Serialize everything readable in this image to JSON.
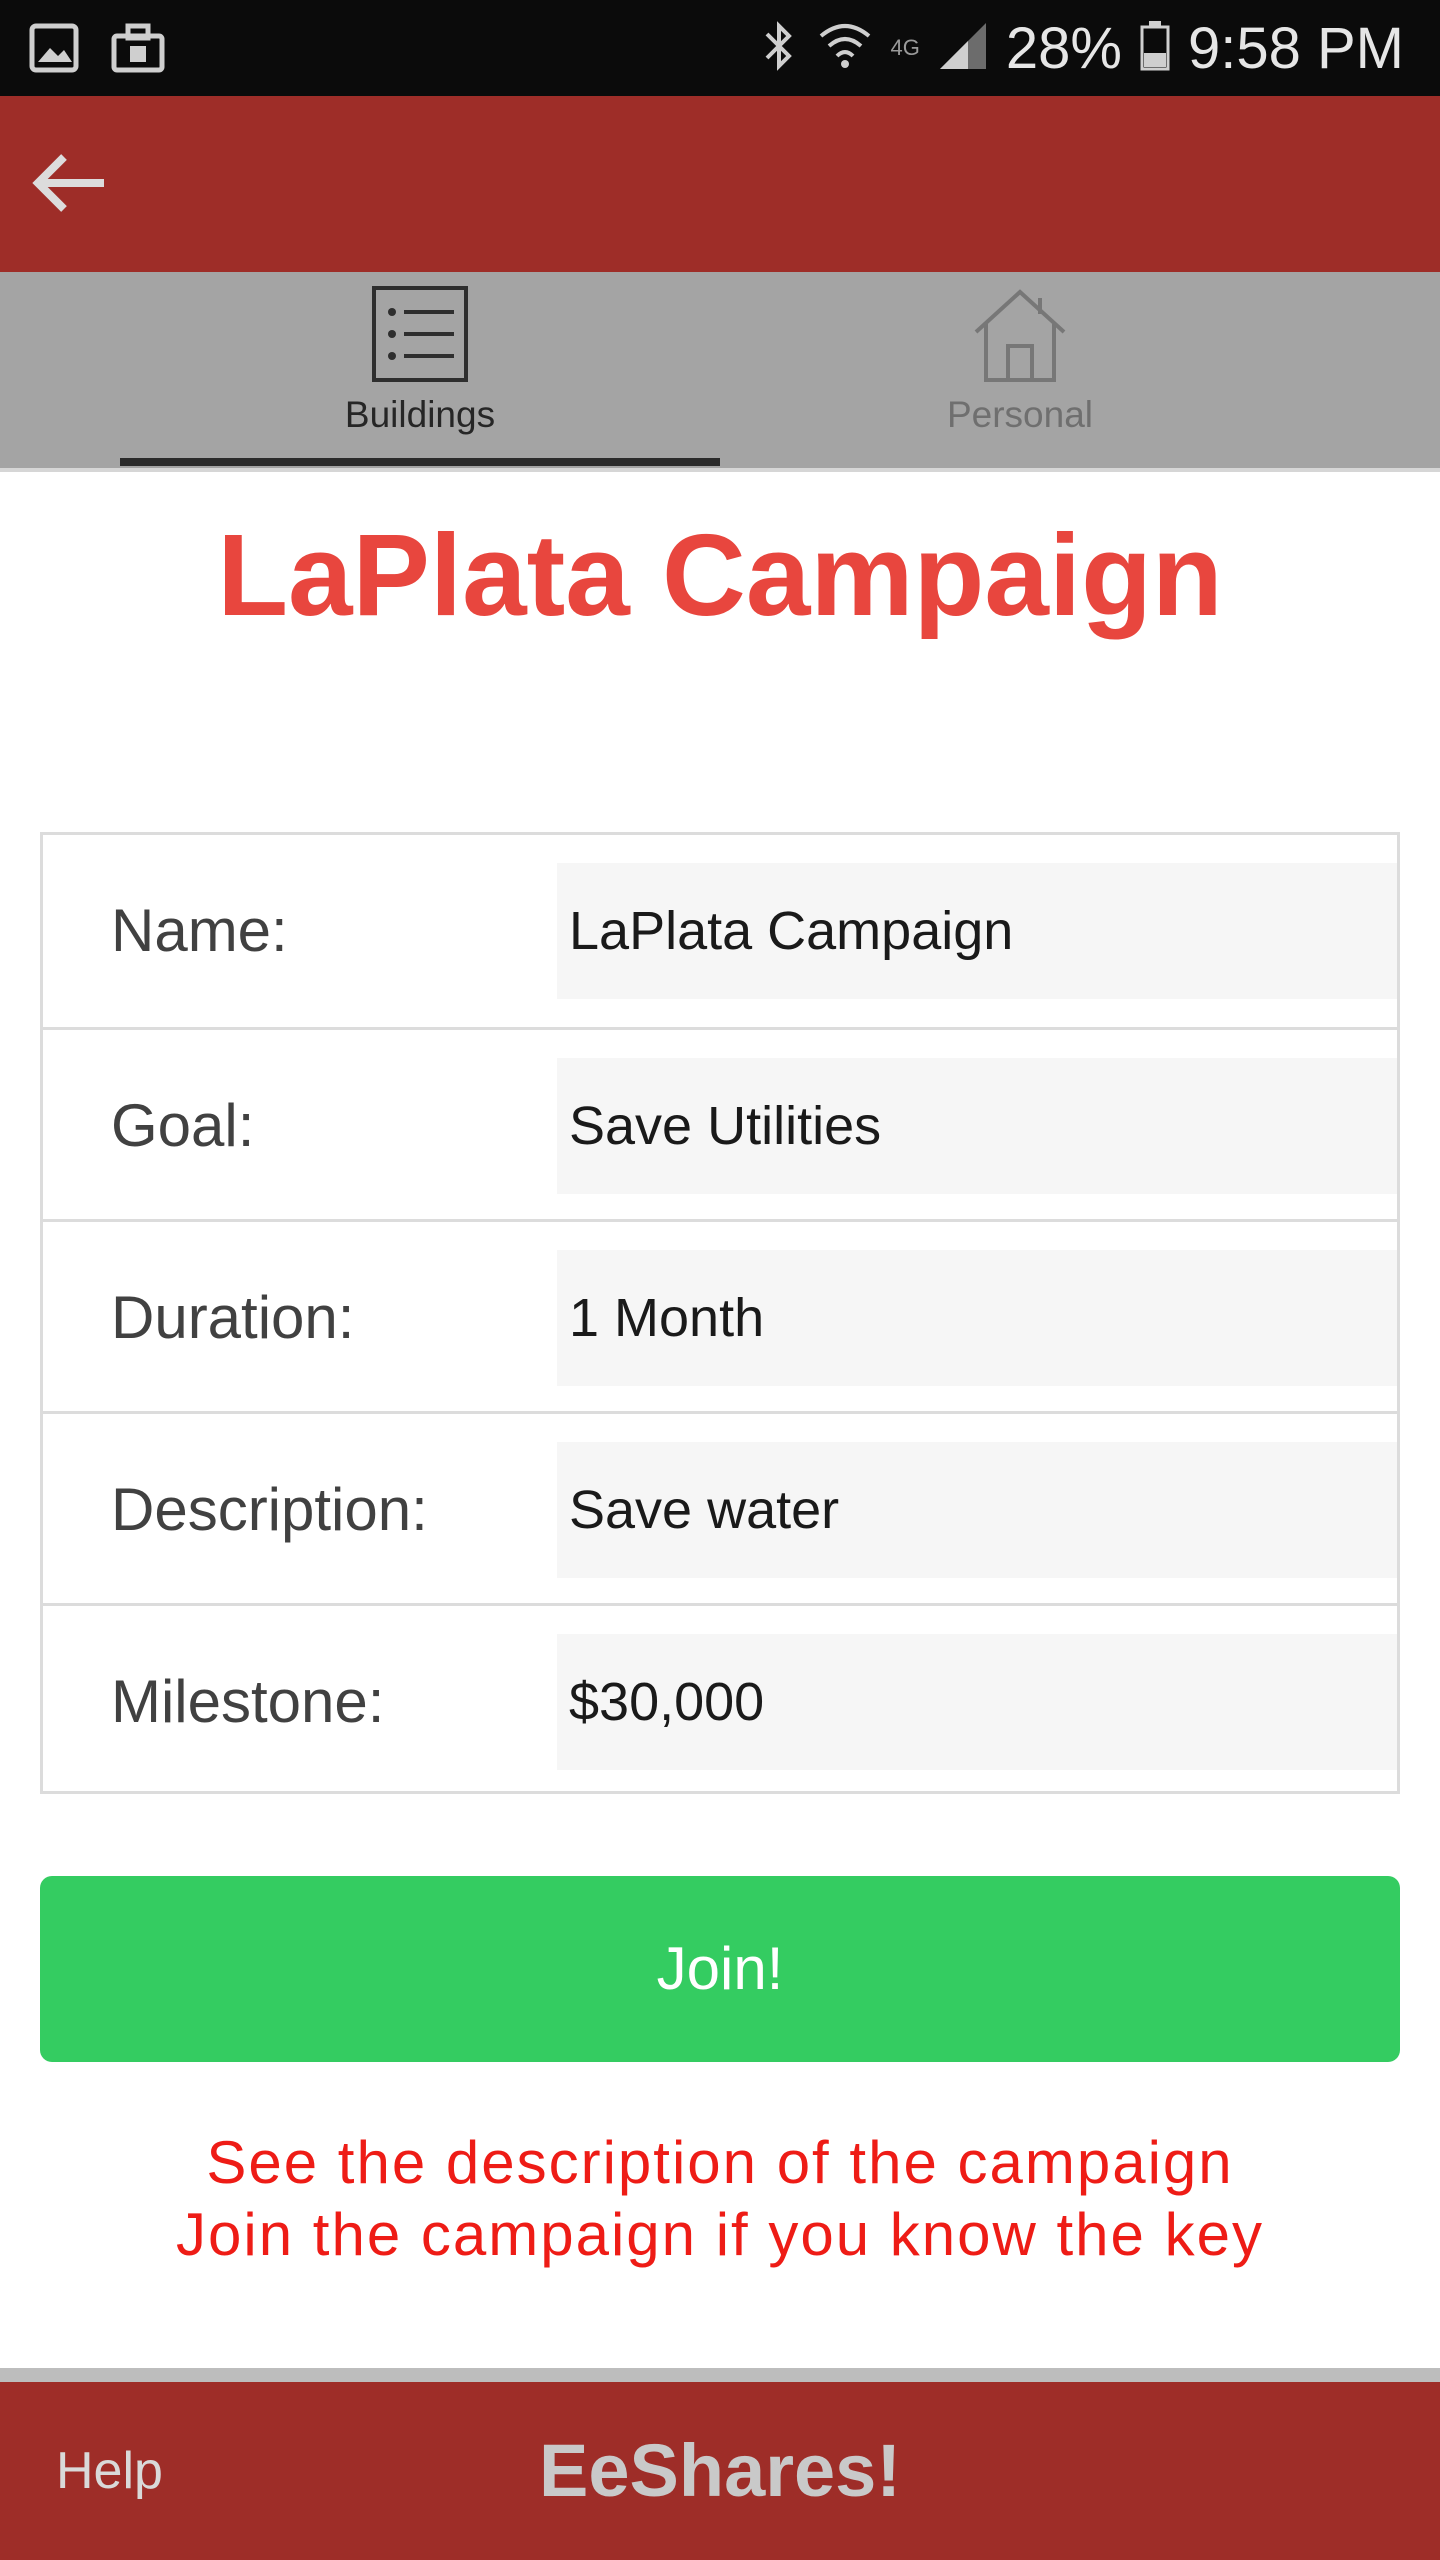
{
  "status_bar": {
    "battery": "28%",
    "time": "9:58 PM",
    "network": "4G",
    "icons": [
      "gallery-icon",
      "briefcase-icon",
      "bluetooth-icon",
      "wifi-icon",
      "signal-icon",
      "battery-icon"
    ]
  },
  "action_bar": {
    "back_icon": "arrow-left-icon",
    "color": "#9e2d28"
  },
  "tabs": [
    {
      "label": "Buildings",
      "icon": "list-icon",
      "active": true
    },
    {
      "label": "Personal",
      "icon": "house-icon",
      "active": false
    }
  ],
  "title": "LaPlata Campaign",
  "details": [
    {
      "label": "Name:",
      "value": "LaPlata Campaign"
    },
    {
      "label": "Goal:",
      "value": "Save Utilities"
    },
    {
      "label": "Duration:",
      "value": "1 Month"
    },
    {
      "label": "Description:",
      "value": "Save water"
    },
    {
      "label": "Milestone:",
      "value": "$30,000"
    }
  ],
  "join_button": {
    "label": "Join!",
    "color": "#34cc61"
  },
  "info": {
    "line1": "See the description of the campaign",
    "line2": "Join the campaign if you know the key",
    "color": "#ee1c16"
  },
  "bottom_bar": {
    "help": "Help",
    "brand": "EeShares!"
  },
  "colors": {
    "title": "#e8463e",
    "bar": "#9e2d28",
    "tab_bar": "#a4a4a4"
  }
}
